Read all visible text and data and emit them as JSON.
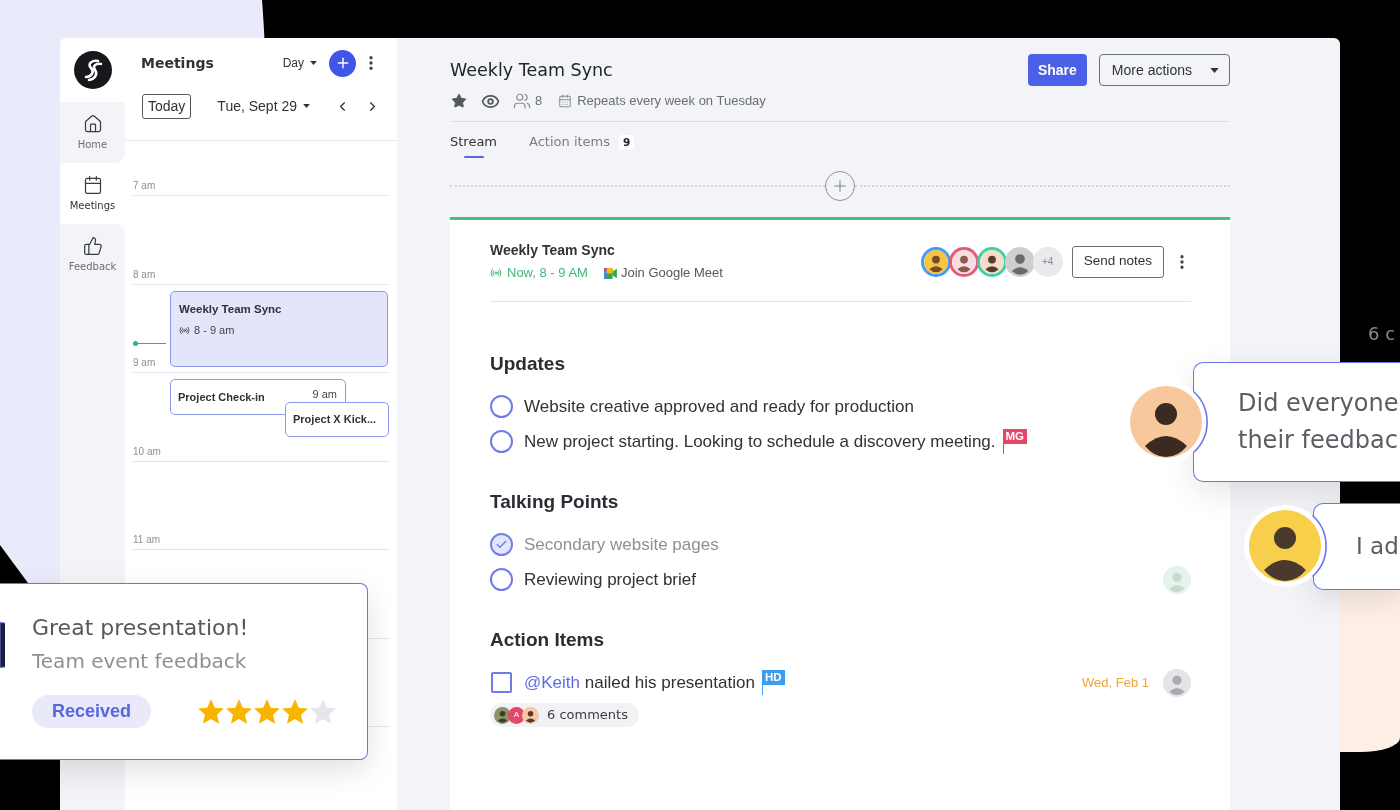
{
  "sidebar": {
    "items": [
      {
        "label": "Home",
        "kind": "home",
        "selected": false
      },
      {
        "label": "Meetings",
        "kind": "calendar",
        "selected": true
      },
      {
        "label": "Feedback",
        "kind": "thumbs_up",
        "selected": false
      }
    ]
  },
  "calendar": {
    "title": "Meetings",
    "view": "Day",
    "today_button": "Today",
    "date": "Tue, Sept 29",
    "hours": [
      "7 am",
      "8 am",
      "9 am",
      "10 am",
      "11 am"
    ],
    "events": [
      {
        "kind": "stacked",
        "title": "Weekly Team Sync",
        "time": "8 - 9 am",
        "live": true,
        "selected": true
      },
      {
        "kind": "inline",
        "title": "Project Check-in",
        "time": "9 am",
        "live": false,
        "selected": false
      },
      {
        "kind": "inline",
        "title": "Project X Kick...",
        "live": false,
        "selected": false
      }
    ]
  },
  "meeting": {
    "title": "Weekly Team Sync",
    "attendee_count": "8",
    "recurrence": "Repeats every week on Tuesday",
    "share_button": "Share",
    "more_button": "More actions"
  },
  "tabs": [
    {
      "label": "Stream",
      "selected": true
    },
    {
      "label": "Action items",
      "badge": "9",
      "selected": false
    }
  ],
  "stream_card": {
    "title": "Weekly Team Sync",
    "status": "Now, 8 - 9 AM",
    "live": true,
    "join_link": "Join Google Meet",
    "attendees": [
      {
        "kind": "photo",
        "color": "#4a9af0"
      },
      {
        "kind": "photo",
        "color": "#e25c79"
      },
      {
        "kind": "photo",
        "color": "#3fcfa6"
      },
      {
        "kind": "photo"
      },
      {
        "kind": "count",
        "label": "+4"
      }
    ],
    "send_button": "Send notes",
    "sections": [
      {
        "title": "Updates",
        "kind": "checklist",
        "items": [
          {
            "text": "Website creative approved and ready for production",
            "checked": false
          },
          {
            "text": "New project starting. Looking to schedule a discovery meeting.",
            "checked": false,
            "flag": {
              "label": "MG",
              "color": "#e5476b"
            }
          }
        ]
      },
      {
        "title": "Talking Points",
        "kind": "checklist",
        "items": [
          {
            "text": "Secondary website pages",
            "checked": true
          },
          {
            "text": "Reviewing project brief",
            "checked": false,
            "assignee": true
          }
        ]
      },
      {
        "title": "Action Items",
        "kind": "tasks",
        "items": [
          {
            "mention": "@Keith",
            "text": "nailed his presentation",
            "checked": false,
            "flag": {
              "label": "HD",
              "color": "#3b9cf0"
            },
            "due": "Wed, Feb 1",
            "assignee": true,
            "comments": {
              "label": "6 comments",
              "avatars": [
                {
                  "kind": "photo"
                },
                {
                  "kind": "initial",
                  "label": "A",
                  "color": "#e5476b"
                },
                {
                  "kind": "photo"
                }
              ]
            }
          }
        ]
      }
    ]
  },
  "feedback_card": {
    "title": "Great presentation!",
    "subtitle": "Team event feedback",
    "status": "Received",
    "stars": 4
  },
  "chat_bubbles": [
    {
      "lines": [
        "Did everyone",
        "their feedbac"
      ]
    },
    {
      "lines": [
        "I ad"
      ]
    }
  ],
  "edge_text": "6 c"
}
